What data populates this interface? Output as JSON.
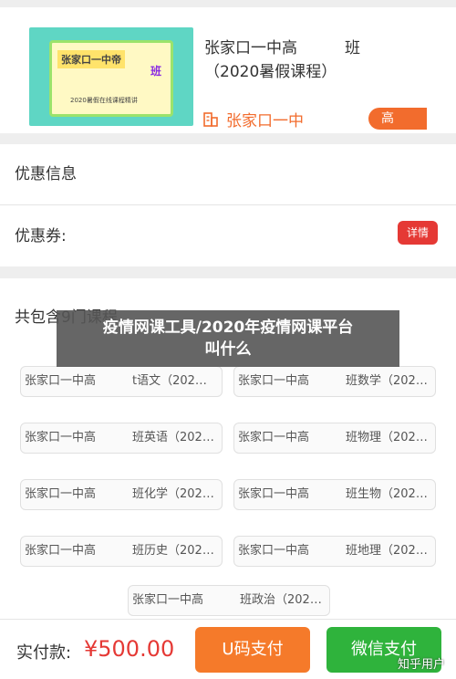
{
  "course": {
    "thumbnail_title": "张家口一中帝",
    "thumbnail_ban": "班",
    "thumbnail_sub": "2020暑假在线课程精讲",
    "title_line1": "张家口一中高",
    "title_line1_end": "班",
    "title_line2": "（2020暑假课程）",
    "school_name": "张家口一中",
    "level_tag": "高"
  },
  "discount": {
    "section_title": "优惠信息",
    "coupon_label": "优惠券:",
    "detail_button": "详情"
  },
  "courses": {
    "header": "共包含9门课程",
    "items": [
      {
        "prefix": "张家口一中高",
        "suffix": "t语文（202…"
      },
      {
        "prefix": "张家口一中高",
        "suffix": "班数学（202…"
      },
      {
        "prefix": "张家口一中高",
        "suffix": "班英语（202…"
      },
      {
        "prefix": "张家口一中高",
        "suffix": "班物理（202…"
      },
      {
        "prefix": "张家口一中高",
        "suffix": "班化学（202…"
      },
      {
        "prefix": "张家口一中高",
        "suffix": "班生物（202…"
      },
      {
        "prefix": "张家口一中高",
        "suffix": "班历史（202…"
      },
      {
        "prefix": "张家口一中高",
        "suffix": "班地理（202…"
      },
      {
        "prefix": "张家口一中高",
        "suffix": "班政治（202…"
      }
    ]
  },
  "overlay": {
    "line1": "疫情网课工具/2020年疫情网课平台",
    "line2": "叫什么"
  },
  "footer": {
    "pay_label": "实付款:",
    "pay_amount": "¥500.00",
    "u_pay_button": "U码支付",
    "wechat_pay_button": "微信支付",
    "watermark": "知乎用户"
  },
  "colors": {
    "accent_orange": "#f26c2d",
    "price_red": "#e53935",
    "wechat_green": "#2fb33c"
  }
}
